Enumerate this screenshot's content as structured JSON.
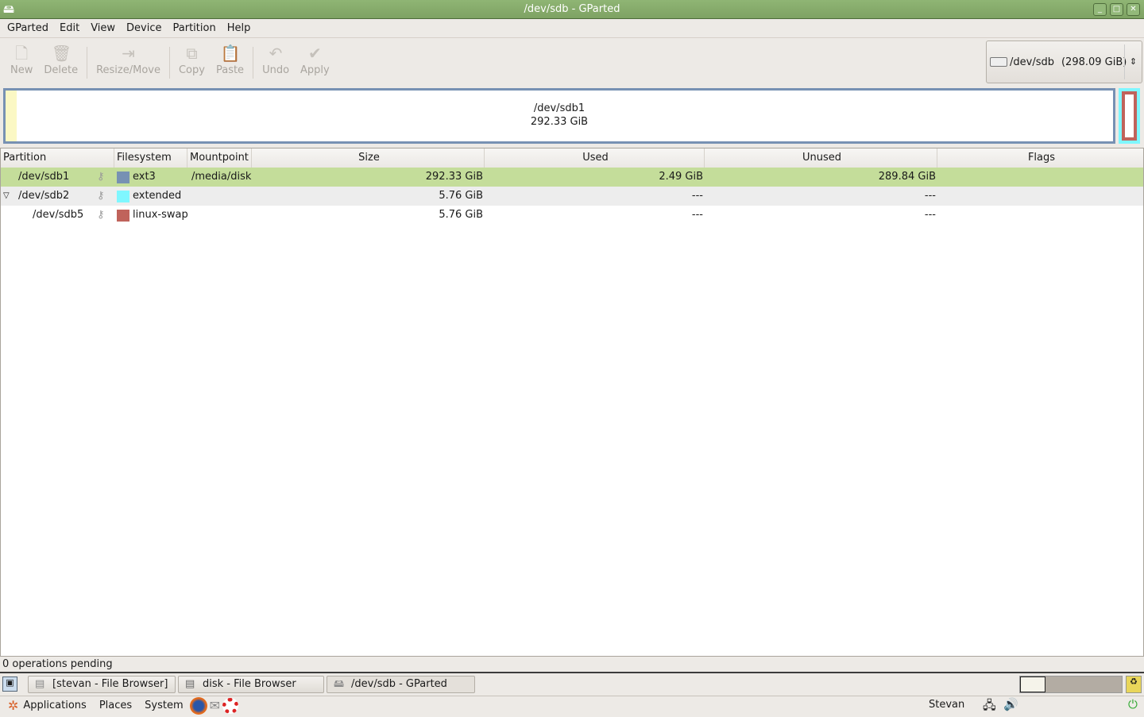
{
  "window": {
    "title": "/dev/sdb - GParted"
  },
  "menu": [
    "GParted",
    "Edit",
    "View",
    "Device",
    "Partition",
    "Help"
  ],
  "toolbar": {
    "new": "New",
    "delete": "Delete",
    "resize": "Resize/Move",
    "copy": "Copy",
    "paste": "Paste",
    "undo": "Undo",
    "apply": "Apply"
  },
  "device": {
    "name": "/dev/sdb",
    "size": "(298.09 GiB)"
  },
  "diskmap": {
    "name": "/dev/sdb1",
    "size": "292.33 GiB"
  },
  "colors": {
    "ext3": "#7791b3",
    "extended": "#7ff7ff",
    "linux-swap": "#c0635b",
    "selected": "#c4dd9a"
  },
  "table": {
    "headers": [
      "Partition",
      "Filesystem",
      "Mountpoint",
      "Size",
      "Used",
      "Unused",
      "Flags"
    ],
    "rows": [
      {
        "partition": "/dev/sdb1",
        "filesystem": "ext3",
        "mountpoint": "/media/disk",
        "size": "292.33 GiB",
        "used": "2.49 GiB",
        "unused": "289.84 GiB",
        "flags": ""
      },
      {
        "partition": "/dev/sdb2",
        "filesystem": "extended",
        "mountpoint": "",
        "size": "5.76 GiB",
        "used": "---",
        "unused": "---",
        "flags": ""
      },
      {
        "partition": "/dev/sdb5",
        "filesystem": "linux-swap",
        "mountpoint": "",
        "size": "5.76 GiB",
        "used": "---",
        "unused": "---",
        "flags": ""
      }
    ]
  },
  "status": "0 operations pending",
  "taskbar": [
    "[stevan - File Browser]",
    "disk - File Browser",
    "/dev/sdb - GParted"
  ],
  "panel": {
    "applications": "Applications",
    "places": "Places",
    "system": "System",
    "user": "Stevan"
  }
}
